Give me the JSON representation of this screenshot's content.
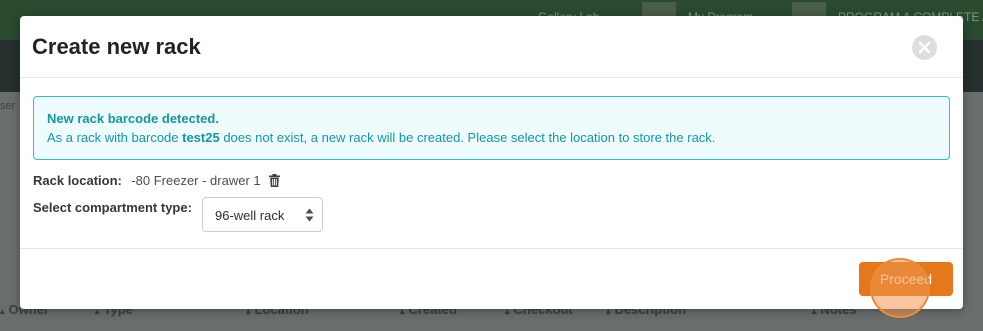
{
  "background": {
    "topbar_text_1": "Gallery Lab",
    "topbar_text_2": "My Program",
    "topbar_text_3": "PROGRAM A COMPLETE A",
    "side_text": "ser",
    "headers": [
      "Owner",
      "Type",
      "Location",
      "Created",
      "Checkout",
      "Description",
      "Notes"
    ]
  },
  "modal": {
    "title": "Create new rack",
    "alert": {
      "title": "New rack barcode detected.",
      "message_before": "As a rack with barcode ",
      "barcode": "test25",
      "message_after": " does not exist, a new rack will be created. Please select the location to store the rack."
    },
    "rack_location": {
      "label": "Rack location:",
      "value": "-80 Freezer - drawer 1"
    },
    "compartment": {
      "label": "Select compartment type:",
      "selected": "96-well rack"
    },
    "proceed_label": "Proceed"
  },
  "colors": {
    "accent": "#e5781a",
    "info": "#1597a0",
    "info_border": "#2ec1c9"
  },
  "icons": [
    "close-icon",
    "trash-icon",
    "select-arrows-icon"
  ]
}
